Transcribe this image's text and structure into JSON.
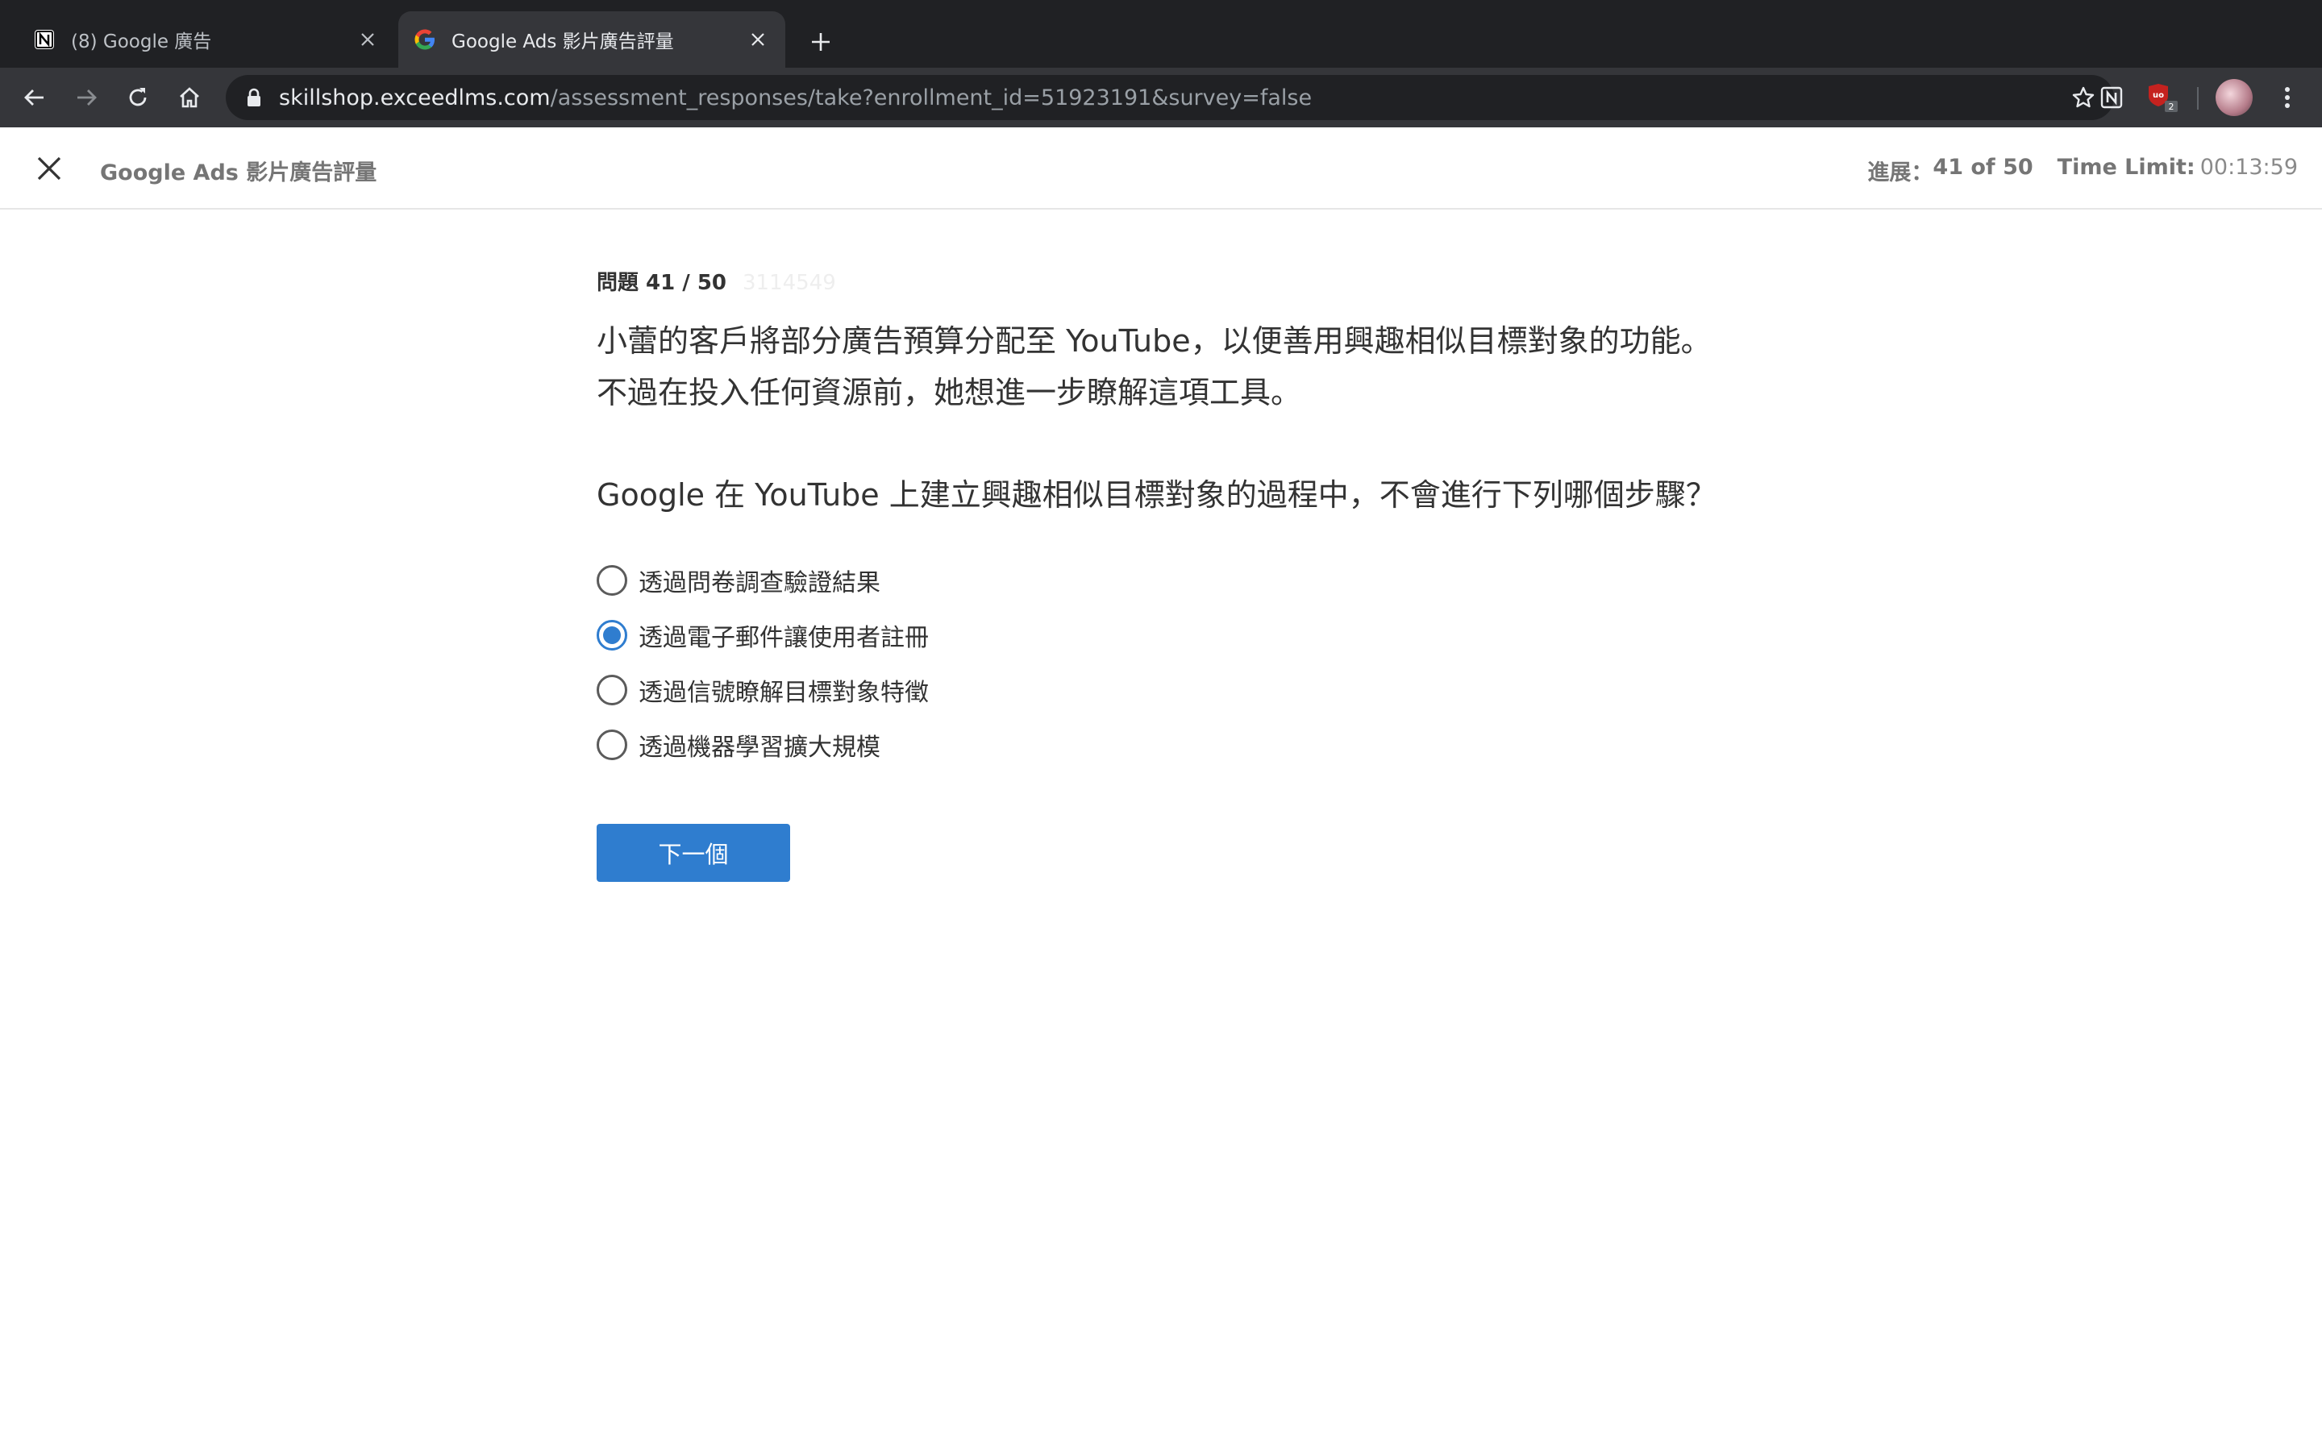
{
  "browser": {
    "tabs": [
      {
        "title": "(8) Google 廣告",
        "favicon": "notion-icon",
        "active": false
      },
      {
        "title": "Google Ads 影片廣告評量",
        "favicon": "google-icon",
        "active": true
      }
    ],
    "url_host": "skillshop.exceedlms.com",
    "url_path": "/assessment_responses/take?enrollment_id=51923191&survey=false",
    "extension_badge": "2"
  },
  "header": {
    "title": "Google Ads 影片廣告評量",
    "progress_label": "進展：",
    "progress_value": "41 of 50",
    "time_limit_label": "Time Limit:",
    "time_limit_value": "00:13:59"
  },
  "question": {
    "number_label": "問題 41 / 50",
    "id": "3114549",
    "scenario": "小蕾的客戶將部分廣告預算分配至 YouTube，以便善用興趣相似目標對象的功能。不過在投入任何資源前，她想進一步瞭解這項工具。",
    "prompt": "Google 在 YouTube 上建立興趣相似目標對象的過程中，不會進行下列哪個步驟？",
    "options": [
      {
        "label": "透過問卷調查驗證結果",
        "selected": false
      },
      {
        "label": "透過電子郵件讓使用者註冊",
        "selected": true
      },
      {
        "label": "透過信號瞭解目標對象特徵",
        "selected": false
      },
      {
        "label": "透過機器學習擴大規模",
        "selected": false
      }
    ],
    "next_label": "下一個"
  },
  "colors": {
    "accent": "#2f7dcf",
    "chrome_dark": "#202124",
    "chrome_toolbar": "#35363a"
  }
}
